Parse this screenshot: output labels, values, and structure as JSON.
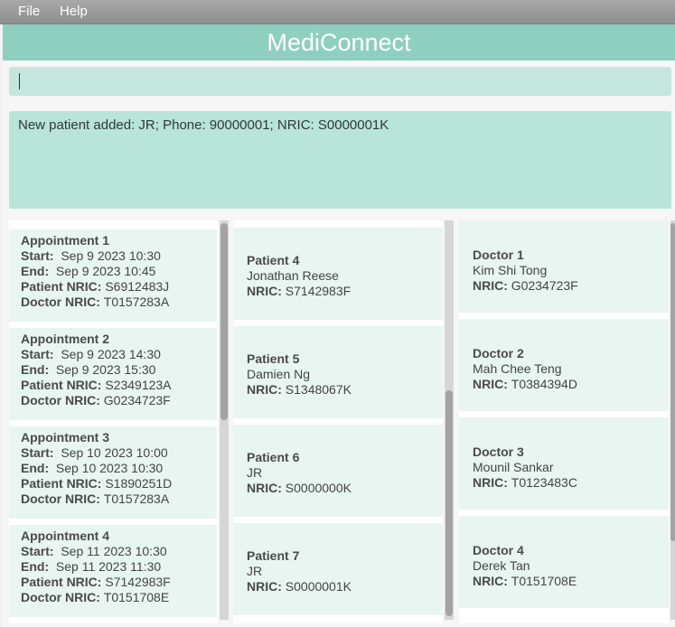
{
  "menu": {
    "file": "File",
    "help": "Help"
  },
  "title": "MediConnect",
  "command": {
    "value": ""
  },
  "result": "New patient added: JR; Phone: 90000001; NRIC: S0000001K",
  "appointments": [
    {
      "title": "Appointment 1",
      "start": "Sep 9 2023 10:30",
      "end": "Sep 9 2023 10:45",
      "patient_nric": "S6912483J",
      "doctor_nric": "T0157283A"
    },
    {
      "title": "Appointment 2",
      "start": "Sep 9 2023 14:30",
      "end": "Sep 9 2023 15:30",
      "patient_nric": "S2349123A",
      "doctor_nric": "G0234723F"
    },
    {
      "title": "Appointment 3",
      "start": "Sep 10 2023 10:00",
      "end": "Sep 10 2023 10:30",
      "patient_nric": "S1890251D",
      "doctor_nric": "T0157283A"
    },
    {
      "title": "Appointment 4",
      "start": "Sep 11 2023 10:30",
      "end": "Sep 11 2023 11:30",
      "patient_nric": "S7142983F",
      "doctor_nric": "T0151708E"
    }
  ],
  "patients": [
    {
      "title": "Patient 4",
      "name": "Jonathan Reese",
      "nric": "S7142983F"
    },
    {
      "title": "Patient 5",
      "name": "Damien Ng",
      "nric": "S1348067K"
    },
    {
      "title": "Patient 6",
      "name": "JR",
      "nric": "S0000000K"
    },
    {
      "title": "Patient 7",
      "name": "JR",
      "nric": "S0000001K"
    }
  ],
  "doctors": [
    {
      "title": "Doctor 1",
      "name": "Kim Shi Tong",
      "nric": "G0234723F"
    },
    {
      "title": "Doctor 2",
      "name": "Mah Chee Teng",
      "nric": "T0384394D"
    },
    {
      "title": "Doctor 3",
      "name": "Mounil Sankar",
      "nric": "T0123483C"
    },
    {
      "title": "Doctor 4",
      "name": "Derek Tan",
      "nric": "T0151708E"
    }
  ],
  "labels": {
    "start": "Start:",
    "end": "End:",
    "patient_nric": "Patient NRIC:",
    "doctor_nric": "Doctor NRIC:",
    "nric": "NRIC:"
  }
}
